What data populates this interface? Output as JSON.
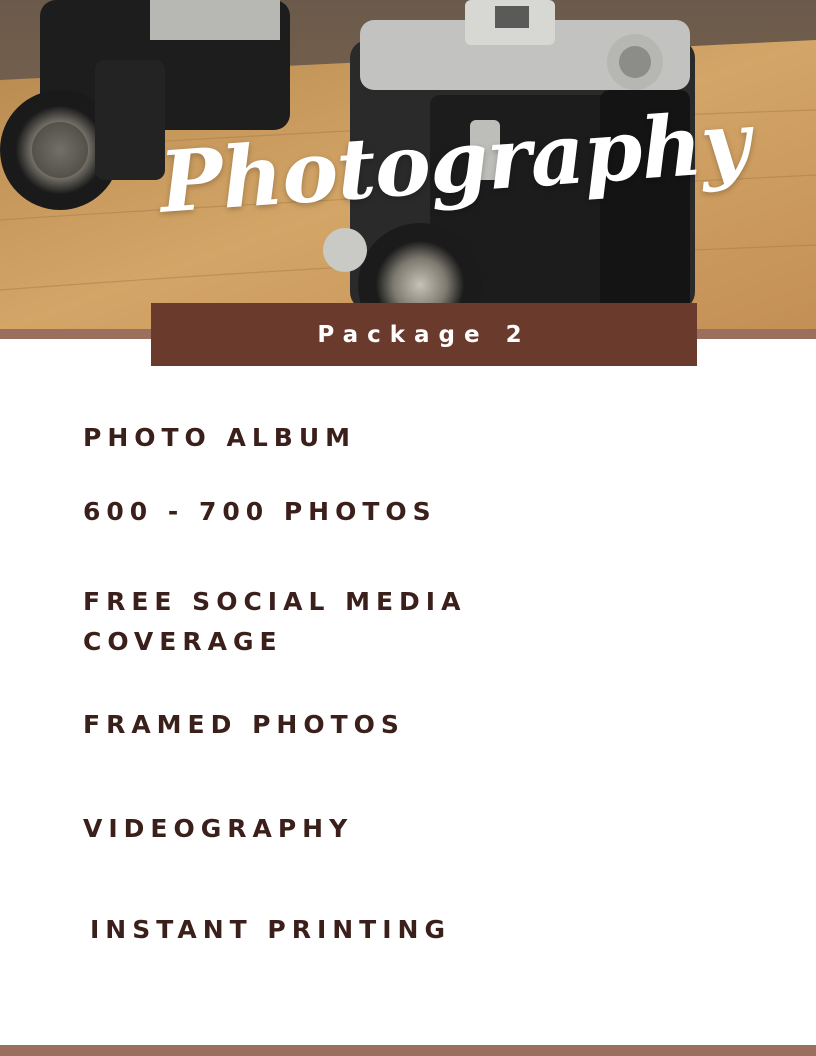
{
  "header": {
    "title_script": "Photography",
    "package_label": "Package 2"
  },
  "features": [
    "PHOTO ALBUM",
    "600 - 700 PHOTOS",
    "FREE SOCIAL MEDIA COVERAGE",
    "FRAMED PHOTOS",
    "VIDEOGRAPHY",
    "INSTANT PRINTING"
  ],
  "colors": {
    "banner": "#6a3b2d",
    "rule": "#9a6f5d",
    "text": "#3b1f1a"
  },
  "icons": {
    "hero": "camera-photo"
  }
}
